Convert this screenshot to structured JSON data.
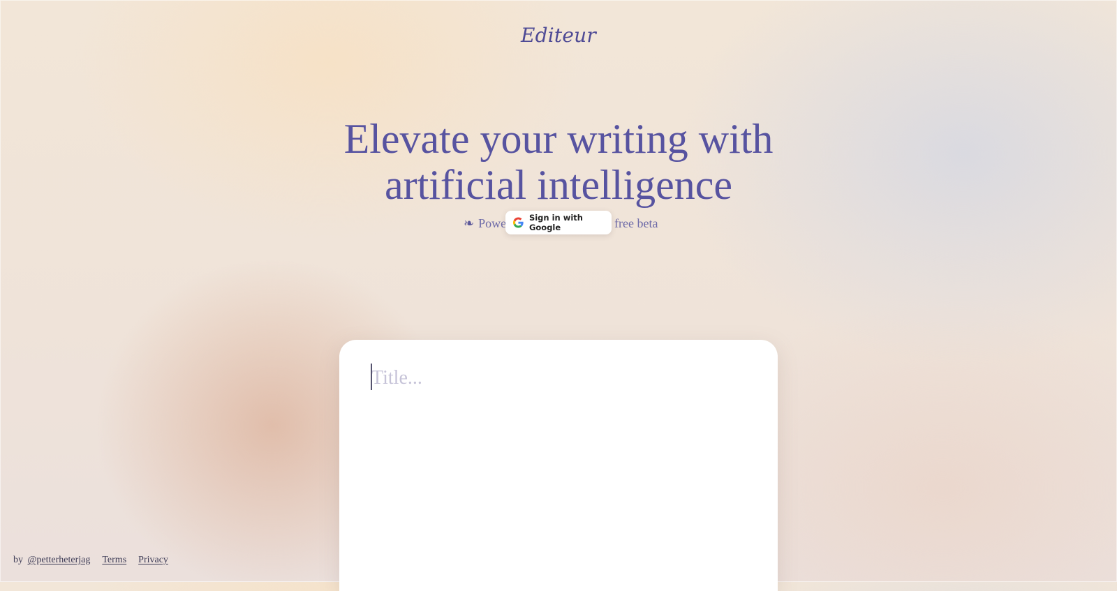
{
  "app": {
    "logo_text": "Editeur"
  },
  "hero": {
    "headline_line1": "Elevate your writing with",
    "headline_line2": "artificial intelligence",
    "sub_left": "Powe",
    "sub_right": "free beta",
    "leaf_glyph": "❧"
  },
  "auth": {
    "google_signin_label": "Sign in with Google"
  },
  "editor": {
    "title_placeholder": "Title..."
  },
  "footer": {
    "by_prefix": "by",
    "author_link": "@petterheterjag",
    "terms_link": "Terms",
    "privacy_link": "Privacy"
  },
  "colors": {
    "brand": "#4e4a95",
    "headline": "#5753a0",
    "subtext": "#6d6aa8",
    "editor_bg": "#ffffff",
    "placeholder": "#c6c3d8"
  },
  "icons": {
    "google": "google-g-icon",
    "leaf": "floral-heart-icon"
  }
}
